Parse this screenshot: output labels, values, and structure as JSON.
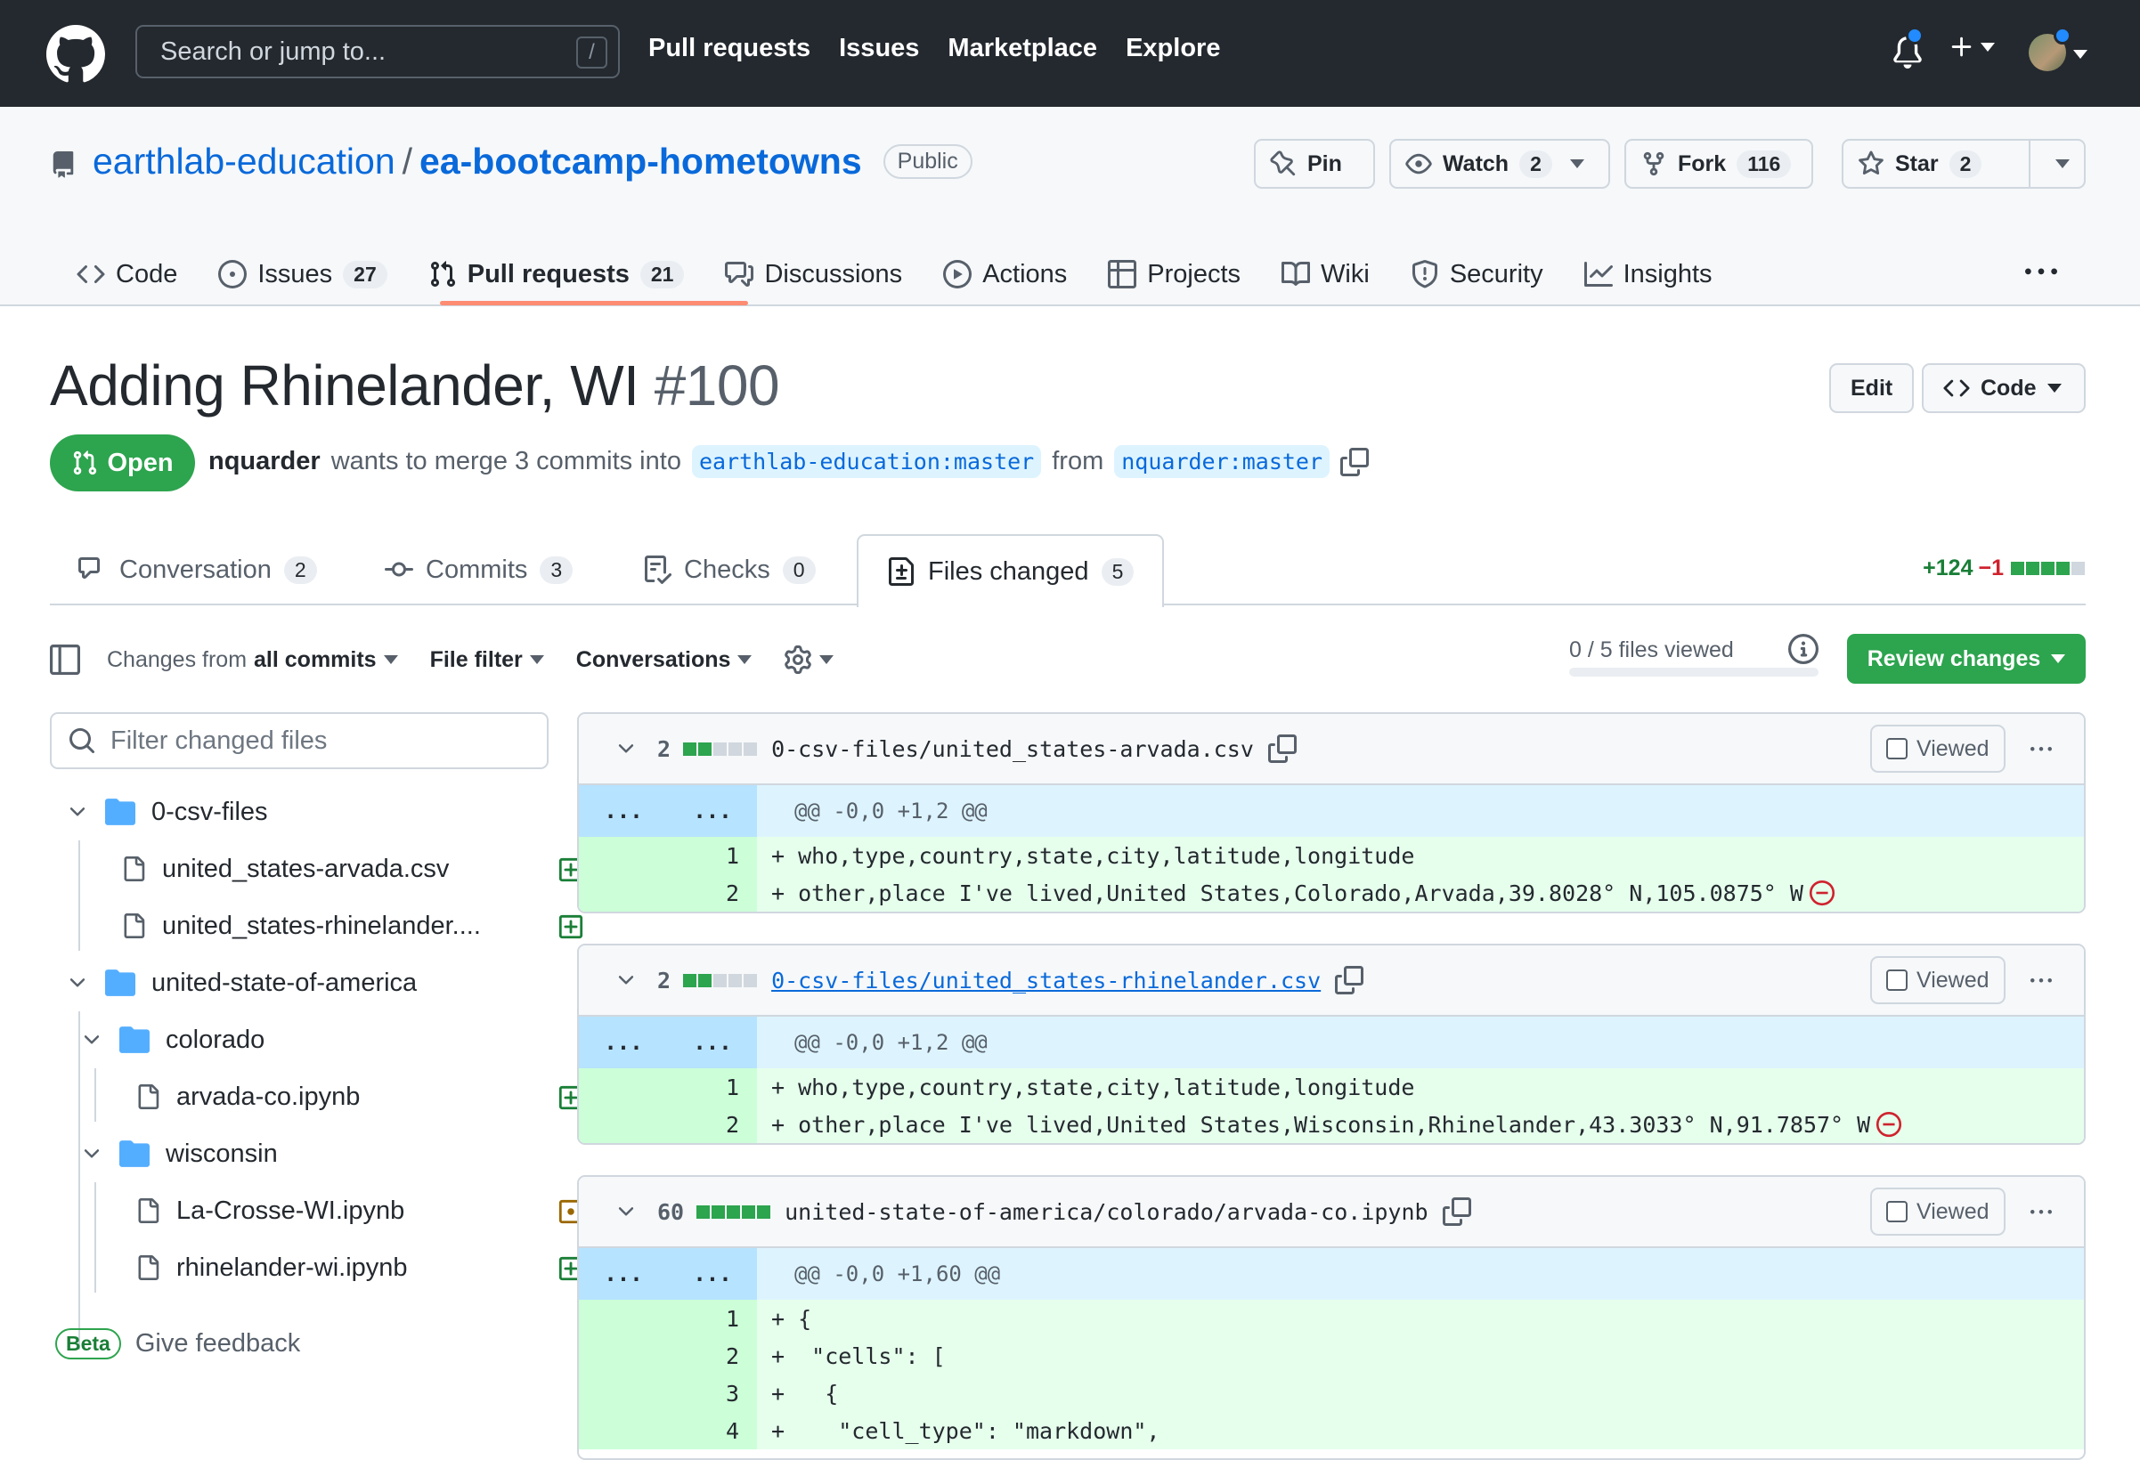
{
  "colors": {
    "header_bg": "#24292f",
    "accent_green": "#2da44e",
    "link_blue": "#0969da",
    "tab_underline": "#fd8c73",
    "added_line_bg": "#e6ffec",
    "hunk_bg": "#ddf4ff"
  },
  "header": {
    "search_placeholder": "Search or jump to...",
    "search_shortcut": "/",
    "nav": [
      "Pull requests",
      "Issues",
      "Marketplace",
      "Explore"
    ]
  },
  "repo": {
    "owner": "earthlab-education",
    "separator": "/",
    "name": "ea-bootcamp-hometowns",
    "visibility": "Public",
    "pin_label": "Pin",
    "watch_label": "Watch",
    "watch_count": "2",
    "fork_label": "Fork",
    "fork_count": "116",
    "star_label": "Star",
    "star_count": "2",
    "tabs": [
      {
        "label": "Code",
        "icon": "code-icon",
        "count": ""
      },
      {
        "label": "Issues",
        "icon": "issue-icon",
        "count": "27"
      },
      {
        "label": "Pull requests",
        "icon": "pull-request-icon",
        "count": "21"
      },
      {
        "label": "Discussions",
        "icon": "discussion-icon",
        "count": ""
      },
      {
        "label": "Actions",
        "icon": "play-icon",
        "count": ""
      },
      {
        "label": "Projects",
        "icon": "table-icon",
        "count": ""
      },
      {
        "label": "Wiki",
        "icon": "book-icon",
        "count": ""
      },
      {
        "label": "Security",
        "icon": "shield-icon",
        "count": ""
      },
      {
        "label": "Insights",
        "icon": "graph-icon",
        "count": ""
      }
    ]
  },
  "pr": {
    "title": "Adding Rhinelander, WI",
    "number": "#100",
    "state": "Open",
    "author": "nquarder",
    "merge_text": "wants to merge 3 commits into",
    "base_branch": "earthlab-education:master",
    "from_text": "from",
    "head_branch": "nquarder:master",
    "edit_label": "Edit",
    "code_label": "Code",
    "tabs": [
      {
        "label": "Conversation",
        "count": "2"
      },
      {
        "label": "Commits",
        "count": "3"
      },
      {
        "label": "Checks",
        "count": "0"
      },
      {
        "label": "Files changed",
        "count": "5"
      }
    ],
    "additions": "+124",
    "deletions": "−1"
  },
  "toolbar": {
    "changes_prefix": "Changes from",
    "changes_value": "all commits",
    "file_filter": "File filter",
    "conversations": "Conversations",
    "files_viewed": "0 / 5 files viewed",
    "review_changes": "Review changes"
  },
  "sidebar": {
    "filter_placeholder": "Filter changed files",
    "tree": [
      {
        "label": "0-csv-files",
        "type": "folder"
      },
      {
        "label": "united_states-arvada.csv",
        "type": "file",
        "status": "added"
      },
      {
        "label": "united_states-rhinelander....",
        "type": "file",
        "status": "added"
      },
      {
        "label": "united-state-of-america",
        "type": "folder"
      },
      {
        "label": "colorado",
        "type": "folder"
      },
      {
        "label": "arvada-co.ipynb",
        "type": "file",
        "status": "added"
      },
      {
        "label": "wisconsin",
        "type": "folder"
      },
      {
        "label": "La-Crosse-WI.ipynb",
        "type": "file",
        "status": "modified"
      },
      {
        "label": "rhinelander-wi.ipynb",
        "type": "file",
        "status": "added"
      }
    ],
    "beta_label": "Beta",
    "feedback_label": "Give feedback"
  },
  "files": [
    {
      "changes": "2",
      "path": "0-csv-files/united_states-arvada.csv",
      "viewed_label": "Viewed",
      "hunk_gutter": "...",
      "hunk_header": "@@ -0,0 +1,2 @@",
      "lines": [
        {
          "num": "1",
          "text": "+ who,type,country,state,city,latitude,longitude"
        },
        {
          "num": "2",
          "text": "+ other,place I've lived,United States,Colorado,Arvada,39.8028° N,105.0875° W"
        }
      ]
    },
    {
      "changes": "2",
      "path": "0-csv-files/united_states-rhinelander.csv",
      "viewed_label": "Viewed",
      "hunk_gutter": "...",
      "hunk_header": "@@ -0,0 +1,2 @@",
      "lines": [
        {
          "num": "1",
          "text": "+ who,type,country,state,city,latitude,longitude"
        },
        {
          "num": "2",
          "text": "+ other,place I've lived,United States,Wisconsin,Rhinelander,43.3033° N,91.7857° W"
        }
      ]
    },
    {
      "changes": "60",
      "path": "united-state-of-america/colorado/arvada-co.ipynb",
      "viewed_label": "Viewed",
      "hunk_gutter": "...",
      "hunk_header": "@@ -0,0 +1,60 @@",
      "lines": [
        {
          "num": "1",
          "text": "+ {"
        },
        {
          "num": "2",
          "text": "+  \"cells\": ["
        },
        {
          "num": "3",
          "text": "+   {"
        },
        {
          "num": "4",
          "text": "+    \"cell_type\": \"markdown\","
        }
      ]
    }
  ]
}
